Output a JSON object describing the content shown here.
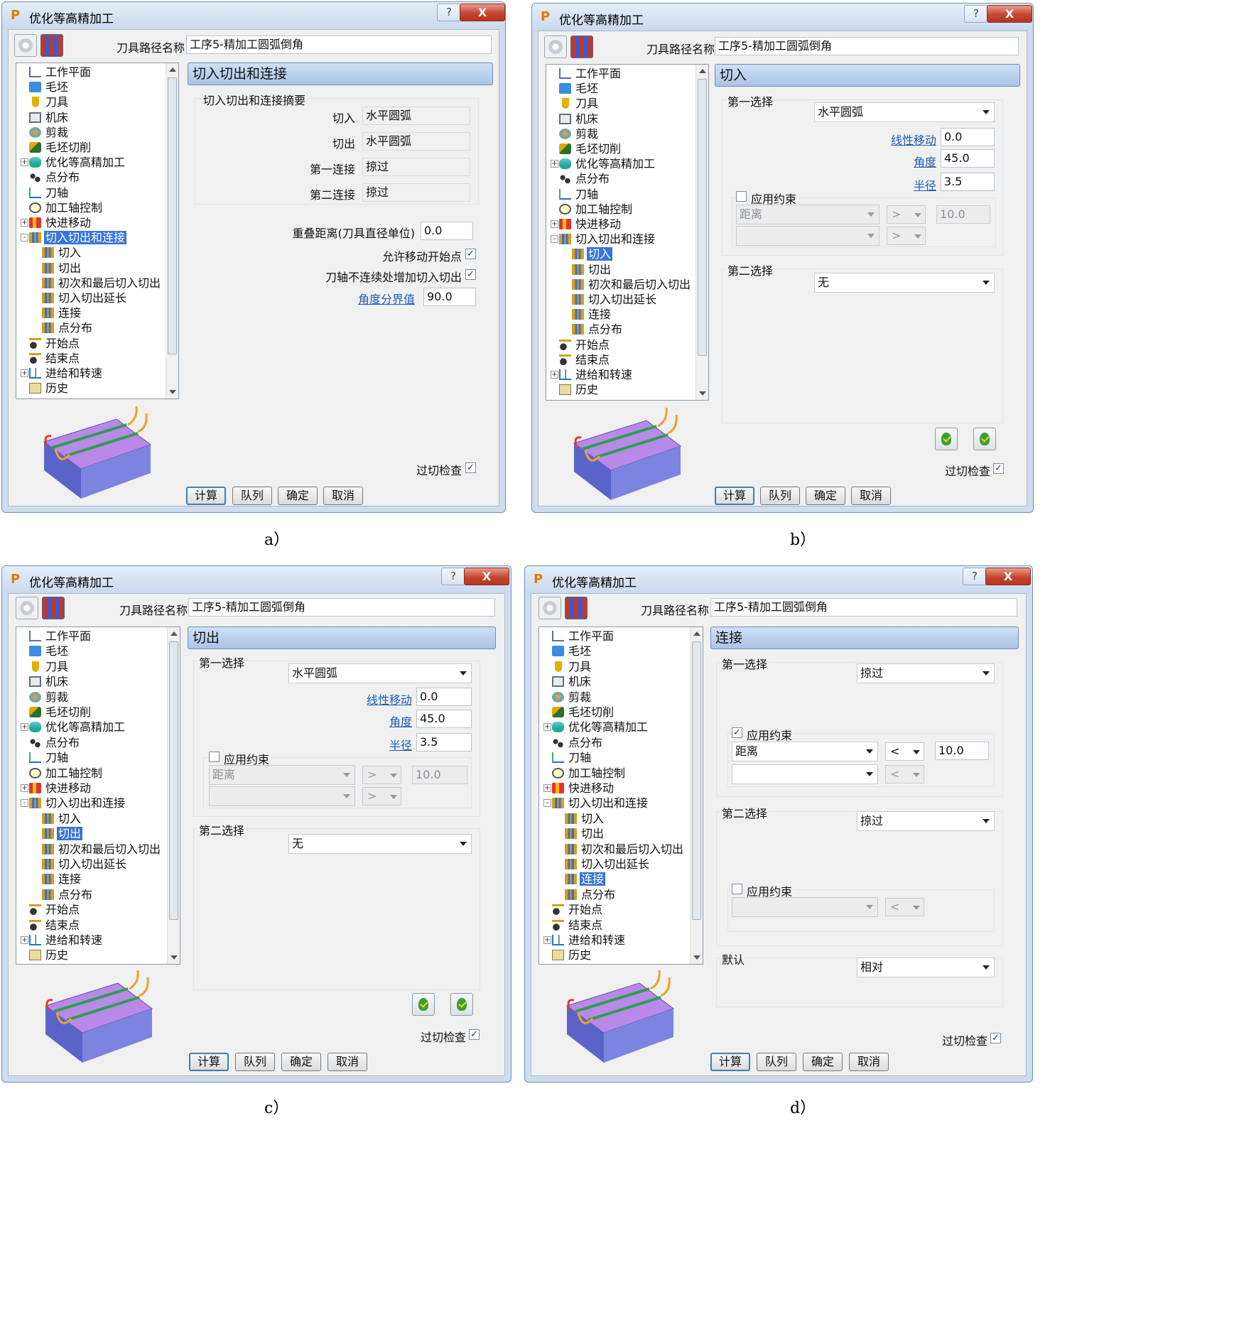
{
  "window_title": "优化等高精加工",
  "common": {
    "toolpath_name_label": "刀具路径名称",
    "toolpath_name_value": "工序5-精加工圆弧倒角",
    "buttons": {
      "calculate": "计算",
      "queue": "队列",
      "ok": "确定",
      "cancel": "取消"
    },
    "gouge_check_label": "过切检查",
    "gouge_check_checked": true,
    "help_glyph": "?",
    "close_glyph": "X",
    "app_icon_glyph": "P"
  },
  "tree_items": [
    {
      "label": "工作平面",
      "icon": "workplane-icon",
      "expander": "",
      "level": 0
    },
    {
      "label": "毛坯",
      "icon": "block-icon",
      "expander": "",
      "level": 0
    },
    {
      "label": "刀具",
      "icon": "tool-icon",
      "expander": "",
      "level": 0
    },
    {
      "label": "机床",
      "icon": "machine-icon",
      "expander": "",
      "level": 0
    },
    {
      "label": "剪裁",
      "icon": "limit-icon",
      "expander": "",
      "level": 0
    },
    {
      "label": "毛坯切削",
      "icon": "stock-cut-icon",
      "expander": "",
      "level": 0
    },
    {
      "label": "优化等高精加工",
      "icon": "strategy-icon",
      "expander": "+",
      "level": 0
    },
    {
      "label": "点分布",
      "icon": "point-distribution-icon",
      "expander": "",
      "level": 0
    },
    {
      "label": "刀轴",
      "icon": "tool-axis-icon",
      "expander": "",
      "level": 0
    },
    {
      "label": "加工轴控制",
      "icon": "axis-control-icon",
      "expander": "",
      "level": 0
    },
    {
      "label": "快进移动",
      "icon": "rapid-move-icon",
      "expander": "+",
      "level": 0
    },
    {
      "label": "切入切出和连接",
      "icon": "leads-links-icon",
      "expander": "-",
      "level": 0
    },
    {
      "label": "切入",
      "icon": "lead-in-icon",
      "expander": "",
      "level": 1
    },
    {
      "label": "切出",
      "icon": "lead-out-icon",
      "expander": "",
      "level": 1
    },
    {
      "label": "初次和最后切入切出",
      "icon": "first-last-lead-icon",
      "expander": "",
      "level": 1
    },
    {
      "label": "切入切出延长",
      "icon": "lead-extension-icon",
      "expander": "",
      "level": 1
    },
    {
      "label": "连接",
      "icon": "links-icon",
      "expander": "",
      "level": 1
    },
    {
      "label": "点分布",
      "icon": "lead-point-distribution-icon",
      "expander": "",
      "level": 1
    },
    {
      "label": "开始点",
      "icon": "start-point-icon",
      "expander": "",
      "level": 0
    },
    {
      "label": "结束点",
      "icon": "end-point-icon",
      "expander": "",
      "level": 0
    },
    {
      "label": "进给和转速",
      "icon": "feeds-speeds-icon",
      "expander": "+",
      "level": 0
    },
    {
      "label": "历史",
      "icon": "history-icon",
      "expander": "",
      "level": 0
    }
  ],
  "panels": {
    "a": {
      "caption": "a）",
      "selected_tree_index": 11,
      "header": "切入切出和连接",
      "summary_group_label": "切入切出和连接摘要",
      "summary": [
        {
          "label": "切入",
          "value": "水平圆弧"
        },
        {
          "label": "切出",
          "value": "水平圆弧"
        },
        {
          "label": "第一连接",
          "value": "掠过"
        },
        {
          "label": "第二连接",
          "value": "掠过"
        }
      ],
      "overlap_label": "重叠距离(刀具直径单位)",
      "overlap_value": "0.0",
      "allow_start_move_label": "允许移动开始点",
      "allow_start_move_checked": true,
      "add_leads_label": "刀轴不连续处增加切入切出",
      "add_leads_checked": true,
      "angle_threshold_label": "角度分界值",
      "angle_threshold_value": "90.0"
    },
    "b": {
      "caption": "b）",
      "selected_tree_index": 12,
      "header": "切入",
      "first_choice_label": "第一选择",
      "first_choice_value": "水平圆弧",
      "linear_move_label": "线性移动",
      "linear_move_value": "0.0",
      "angle_label": "角度",
      "angle_value": "45.0",
      "radius_label": "半径",
      "radius_value": "3.5",
      "apply_constraint_label": "应用约束",
      "apply_constraint_checked": false,
      "constraint_type": "距离",
      "constraint_op": ">",
      "constraint_value": "10.0",
      "constraint2_op": ">",
      "second_choice_label": "第二选择",
      "second_choice_value": "无"
    },
    "c": {
      "caption": "c）",
      "selected_tree_index": 13,
      "header": "切出",
      "first_choice_label": "第一选择",
      "first_choice_value": "水平圆弧",
      "linear_move_label": "线性移动",
      "linear_move_value": "0.0",
      "angle_label": "角度",
      "angle_value": "45.0",
      "radius_label": "半径",
      "radius_value": "3.5",
      "apply_constraint_label": "应用约束",
      "apply_constraint_checked": false,
      "constraint_type": "距离",
      "constraint_op": ">",
      "constraint_value": "10.0",
      "constraint2_op": ">",
      "second_choice_label": "第二选择",
      "second_choice_value": "无"
    },
    "d": {
      "caption": "d）",
      "selected_tree_index": 16,
      "header": "连接",
      "first_choice_label": "第一选择",
      "first_choice_value": "掠过",
      "apply_constraint1_label": "应用约束",
      "apply_constraint1_checked": true,
      "constraint_type": "距离",
      "constraint_op": "<",
      "constraint_value": "10.0",
      "constraint2_op": "<",
      "second_choice_label": "第二选择",
      "second_choice_value": "掠过",
      "apply_constraint2_label": "应用约束",
      "apply_constraint2_checked": false,
      "constraint3_op": "<",
      "default_label": "默认",
      "default_value": "相对"
    }
  },
  "colors": {
    "title_bar": "#cfdcee",
    "header_blue": "#a9c4e6",
    "tree_selection": "#3875d7",
    "link_blue": "#1a5fb4",
    "close_red": "#c44632"
  }
}
